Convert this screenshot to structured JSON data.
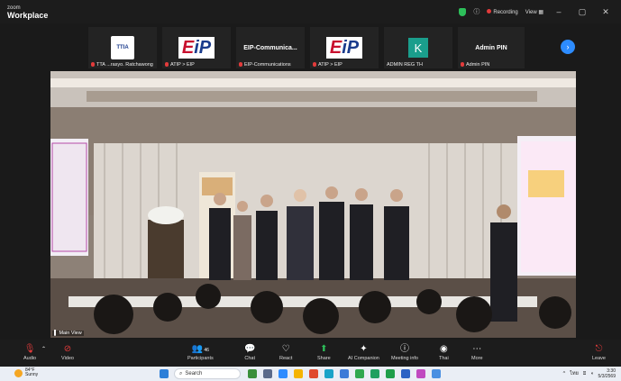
{
  "app": {
    "brand_top": "zoom",
    "brand_bottom": "Workplace"
  },
  "titlebar": {
    "recording": "Recording",
    "view": "View"
  },
  "gallery": [
    {
      "display": "",
      "name": "TTA ...rasyo. Ratchawong"
    },
    {
      "display": "",
      "name": "ATIP > EIP"
    },
    {
      "display": "EIP-Communica...",
      "name": "EIP-Communications"
    },
    {
      "display": "",
      "name": "ATIP > EIP"
    },
    {
      "display": "K",
      "name": "ADMIN REG TH"
    },
    {
      "display": "Admin PIN",
      "name": "Admin PIN"
    }
  ],
  "video": {
    "label": "Main View"
  },
  "toolbar": {
    "audio": "Audio",
    "video": "Video",
    "participants": "Participants",
    "participants_count": "46",
    "chat": "Chat",
    "react": "React",
    "share": "Share",
    "ai": "AI Companion",
    "meeting_info": "Meeting info",
    "language": "Thai",
    "more": "More",
    "leave": "Leave"
  },
  "taskbar": {
    "temp": "84°F",
    "weather": "Sunny",
    "search_placeholder": "Search",
    "lang": "ไทย",
    "time": "3:30",
    "date": "5/3/2569"
  }
}
